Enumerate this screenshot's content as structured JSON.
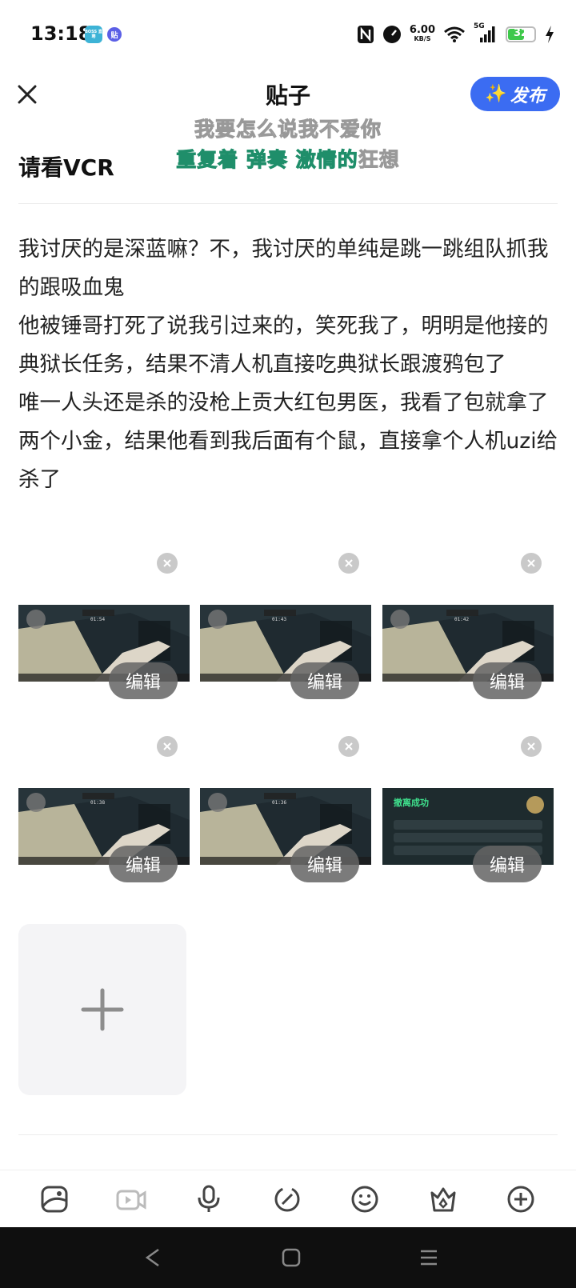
{
  "status_bar": {
    "time": "13:18",
    "apps": [
      "BOSS 直聘",
      "贴"
    ],
    "net_speed_value": "6.00",
    "net_speed_unit": "KB/S",
    "signal_label": "5G",
    "battery_level": "32"
  },
  "header": {
    "title": "贴子",
    "publish_label": "发布",
    "publish_sparkle": "✨"
  },
  "lyrics": {
    "line1": "我要怎么说我不爱你",
    "line2_highlight": "重复着 弹奏 激情的",
    "line2_rest": "狂想"
  },
  "post": {
    "title": "请看VCR",
    "paragraphs": [
      "我讨厌的是深蓝嘛？不，我讨厌的单纯是跳一跳组队抓我的跟吸血鬼",
      "他被锤哥打死了说我引过来的，笑死我了，明明是他接的典狱长任务，结果不清人机直接吃典狱长跟渡鸦包了",
      "唯一人头还是杀的没枪上贡大红包男医，我看了包就拿了两个小金，结果他看到我后面有个鼠，直接拿个人机uzi给杀了"
    ]
  },
  "images": [
    {
      "timer": "01:54",
      "edit_label": "编辑",
      "kind": "gameplay"
    },
    {
      "timer": "01:43",
      "edit_label": "编辑",
      "kind": "gameplay"
    },
    {
      "timer": "01:42",
      "edit_label": "编辑",
      "kind": "gameplay"
    },
    {
      "timer": "01:38",
      "edit_label": "编辑",
      "kind": "gameplay"
    },
    {
      "timer": "01:36",
      "edit_label": "编辑",
      "kind": "gameplay"
    },
    {
      "title": "撤离成功",
      "edit_label": "编辑",
      "kind": "result"
    }
  ],
  "add_image_icon": "plus-icon",
  "toolbar": [
    "image-icon",
    "video-icon",
    "microphone-icon",
    "link-icon",
    "emoji-icon",
    "crown-icon",
    "add-icon"
  ],
  "colors": {
    "accent": "#3b6cf2",
    "lyric_highlight": "#34c79a",
    "battery": "#3ec84a"
  }
}
